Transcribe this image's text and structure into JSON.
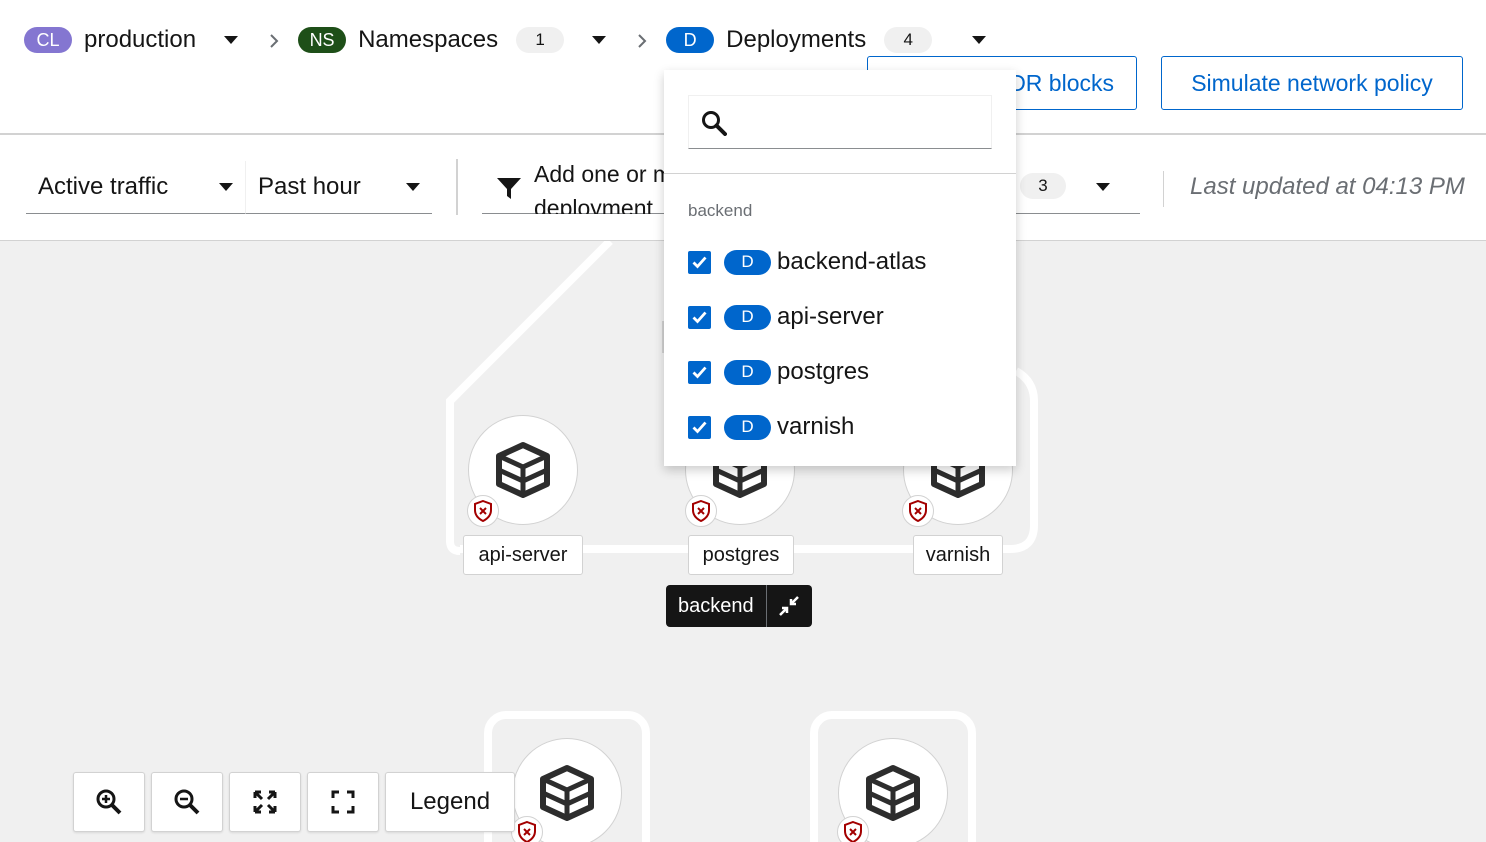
{
  "breadcrumb": {
    "cluster": {
      "badge": "CL",
      "label": "production"
    },
    "namespaces": {
      "badge": "NS",
      "label": "Namespaces",
      "count": "1"
    },
    "deployments": {
      "badge": "D",
      "label": "Deployments",
      "count": "4"
    }
  },
  "header_buttons": {
    "cidr_label": "DR blocks",
    "simulate_label": "Simulate network policy"
  },
  "toolbar": {
    "traffic_select": "Active traffic",
    "time_select": "Past hour",
    "filter_placeholder": "Add one or more deployment",
    "filter_count": "3",
    "last_updated": "Last updated at 04:13 PM"
  },
  "graph": {
    "group_label": "backend",
    "nodes": [
      {
        "label": "api-server"
      },
      {
        "label": "postgres"
      },
      {
        "label": "varnish"
      }
    ]
  },
  "zoom": {
    "legend_label": "Legend"
  },
  "dropdown": {
    "search_placeholder": "",
    "group_title": "backend",
    "items": [
      {
        "badge": "D",
        "name": "backend-atlas",
        "checked": true
      },
      {
        "badge": "D",
        "name": "api-server",
        "checked": true
      },
      {
        "badge": "D",
        "name": "postgres",
        "checked": true
      },
      {
        "badge": "D",
        "name": "varnish",
        "checked": true
      }
    ]
  },
  "colors": {
    "primary": "#0066cc",
    "cluster_badge": "#8476d1",
    "namespace_badge": "#1e4f18",
    "danger": "#a30000"
  },
  "icons": [
    "caret-down-icon",
    "chevron-right-icon",
    "filter-icon",
    "search-icon",
    "deployment-cube-icon",
    "shield-x-icon",
    "collapse-icon",
    "zoom-in-icon",
    "zoom-out-icon",
    "fit-icon",
    "reset-icon",
    "checkmark-icon"
  ]
}
